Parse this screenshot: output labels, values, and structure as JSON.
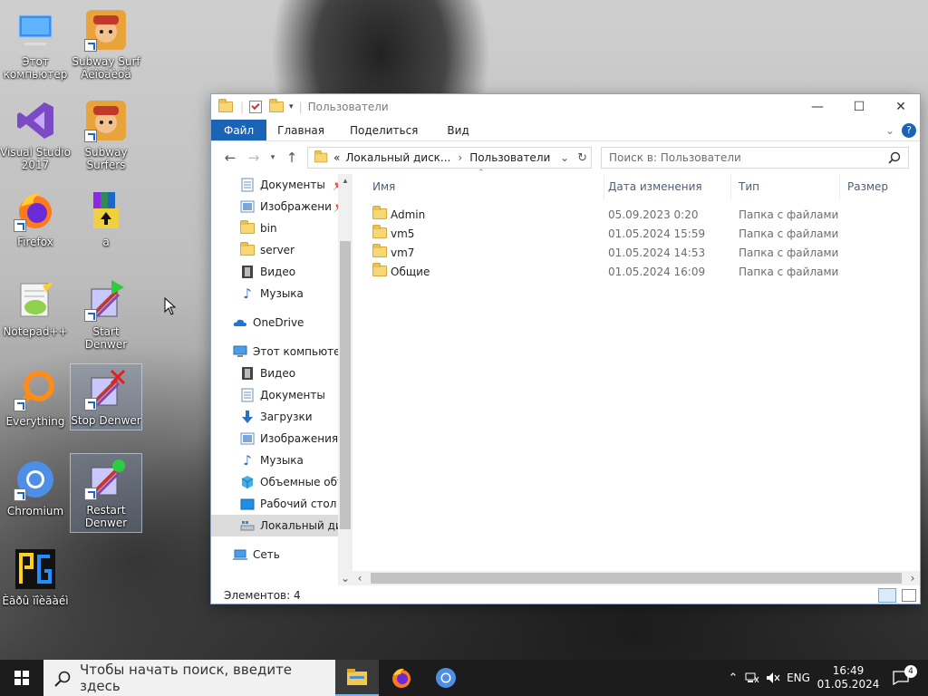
{
  "desktop": {
    "icons": [
      {
        "label": "Этот\nкомпьютер"
      },
      {
        "label": "Subway Surf\nÂëîõàèöå"
      },
      {
        "label": "Visual Studio\n2017"
      },
      {
        "label": "Subway\nSurfers"
      },
      {
        "label": "Firefox"
      },
      {
        "label": "a"
      },
      {
        "label": "Notepad++"
      },
      {
        "label": "Start Denwer"
      },
      {
        "label": "Everything"
      },
      {
        "label": "Stop Denwer"
      },
      {
        "label": "Chromium"
      },
      {
        "label": "Restart\nDenwer"
      },
      {
        "label": "Èãðû ïîèãàéì"
      }
    ]
  },
  "window": {
    "title": "Пользователи",
    "ribbon_tabs": [
      "Файл",
      "Главная",
      "Поделиться",
      "Вид"
    ],
    "address": {
      "prefix": "«",
      "parent": "Локальный диск...",
      "current": "Пользователи"
    },
    "search_placeholder": "Поиск в: Пользователи",
    "nav_items": [
      {
        "label": "Документы"
      },
      {
        "label": "Изображени"
      },
      {
        "label": "bin"
      },
      {
        "label": "server"
      },
      {
        "label": "Видео"
      },
      {
        "label": "Музыка"
      },
      {
        "label": "OneDrive"
      },
      {
        "label": "Этот компьютер"
      },
      {
        "label": "Видео"
      },
      {
        "label": "Документы"
      },
      {
        "label": "Загрузки"
      },
      {
        "label": "Изображения"
      },
      {
        "label": "Музыка"
      },
      {
        "label": "Объемные объ"
      },
      {
        "label": "Рабочий стол"
      },
      {
        "label": "Локальный дис"
      },
      {
        "label": "Сеть"
      }
    ],
    "columns": [
      "Имя",
      "Дата изменения",
      "Тип",
      "Размер"
    ],
    "files": [
      {
        "name": "Admin",
        "date": "05.09.2023 0:20",
        "type": "Папка с файлами"
      },
      {
        "name": "vm5",
        "date": "01.05.2024 15:59",
        "type": "Папка с файлами"
      },
      {
        "name": "vm7",
        "date": "01.05.2024 14:53",
        "type": "Папка с файлами"
      },
      {
        "name": "Общие",
        "date": "01.05.2024 16:09",
        "type": "Папка с файлами"
      }
    ],
    "status_text": "Элементов: 4"
  },
  "taskbar": {
    "search_placeholder": "Чтобы начать поиск, введите здесь",
    "language": "ENG",
    "time": "16:49",
    "date": "01.05.2024",
    "notification_count": "4"
  },
  "colors": {
    "accent": "#1a63b7",
    "folder": "#f7d774",
    "taskbar": "#1c1c1c"
  }
}
